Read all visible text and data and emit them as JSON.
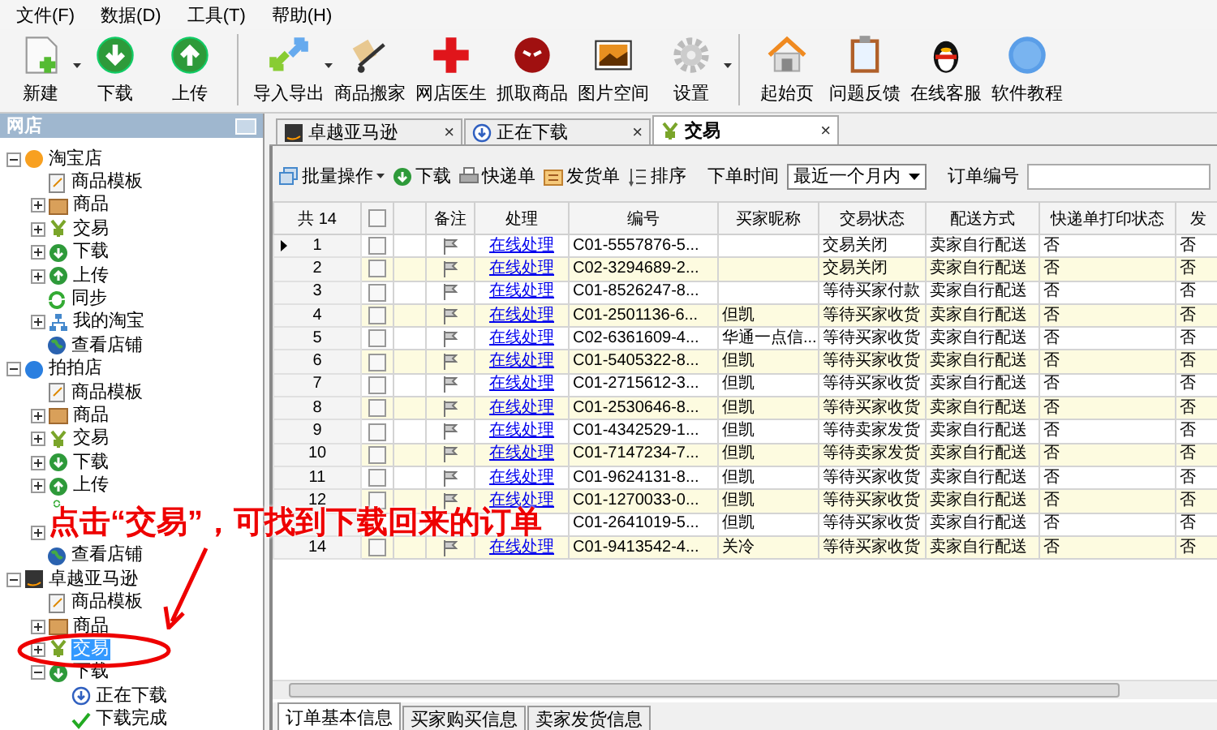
{
  "menu": [
    "文件(F)",
    "数据(D)",
    "工具(T)",
    "帮助(H)"
  ],
  "toolbar": [
    {
      "label": "新建",
      "dropdown": true
    },
    {
      "label": "下载"
    },
    {
      "label": "上传",
      "separator_after": true
    },
    {
      "label": "导入导出",
      "dropdown": true
    },
    {
      "label": "商品搬家"
    },
    {
      "label": "网店医生"
    },
    {
      "label": "抓取商品"
    },
    {
      "label": "图片空间"
    },
    {
      "label": "设置",
      "dropdown": true,
      "separator_after": true
    },
    {
      "label": "起始页"
    },
    {
      "label": "问题反馈"
    },
    {
      "label": "在线客服"
    },
    {
      "label": "软件教程"
    }
  ],
  "sidebar": {
    "title": "网店",
    "tree": [
      {
        "label": "淘宝店",
        "kind": "taobao",
        "expanded": true,
        "selected": false,
        "children": [
          {
            "label": "商品模板",
            "kind": "template",
            "selected": false
          },
          {
            "label": "商品",
            "kind": "box",
            "expanded": false,
            "selected": false
          },
          {
            "label": "交易",
            "kind": "yen",
            "expanded": false,
            "selected": false
          },
          {
            "label": "下载",
            "kind": "download",
            "expanded": false,
            "selected": false
          },
          {
            "label": "上传",
            "kind": "upload",
            "expanded": false,
            "selected": false
          },
          {
            "label": "同步",
            "kind": "sync",
            "selected": false
          },
          {
            "label": "我的淘宝",
            "kind": "sitemap",
            "expanded": false,
            "selected": false
          },
          {
            "label": "查看店铺",
            "kind": "globe",
            "selected": false
          }
        ]
      },
      {
        "label": "拍拍店",
        "kind": "paipai",
        "expanded": true,
        "selected": false,
        "children": [
          {
            "label": "商品模板",
            "kind": "template",
            "selected": false
          },
          {
            "label": "商品",
            "kind": "box",
            "expanded": false,
            "selected": false
          },
          {
            "label": "交易",
            "kind": "yen",
            "expanded": false,
            "selected": false
          },
          {
            "label": "下载",
            "kind": "download",
            "expanded": false,
            "selected": false
          },
          {
            "label": "上传",
            "kind": "upload",
            "expanded": false,
            "selected": false
          },
          {
            "kind": "sync",
            "clipped": true
          },
          {
            "expanded": false
          },
          {
            "label": "查看店铺",
            "kind": "globe",
            "selected": false
          }
        ]
      },
      {
        "label": "卓越亚马逊",
        "kind": "amazon",
        "expanded": true,
        "selected": false,
        "children": [
          {
            "label": "商品模板",
            "kind": "template",
            "selected": false
          },
          {
            "label": "商品",
            "kind": "box",
            "expanded": false,
            "selected": false
          },
          {
            "label": "交易",
            "kind": "yen",
            "expanded": false,
            "selected": true
          },
          {
            "label": "下载",
            "kind": "download",
            "expanded": true,
            "selected": false,
            "children": [
              {
                "label": "正在下载",
                "kind": "downloading",
                "selected": false
              },
              {
                "label": "下载完成",
                "kind": "check",
                "selected": false
              }
            ]
          }
        ]
      }
    ]
  },
  "tabs": [
    {
      "label": "卓越亚马逊",
      "kind": "amazon",
      "selected": false,
      "close": "×"
    },
    {
      "label": "正在下载",
      "kind": "downloading",
      "selected": false,
      "close": "×"
    },
    {
      "label": "交易",
      "kind": "yen",
      "selected": true,
      "close": "×"
    }
  ],
  "order_toolbar": {
    "buttons": [
      {
        "label": "批量操作",
        "dropdown": true
      },
      {
        "label": "下载"
      },
      {
        "label": "快递单"
      },
      {
        "label": "发货单"
      },
      {
        "label": "排序"
      }
    ],
    "time_label": "下单时间",
    "time_value": "最近一个月内",
    "order_no_label": "订单编号"
  },
  "table": {
    "count": "共 14",
    "select_all_checked": false,
    "columns": [
      "",
      "备注",
      "处理",
      "编号",
      "买家昵称",
      "交易状态",
      "配送方式",
      "快递单打印状态",
      "发"
    ],
    "rows": [
      {
        "index": "1",
        "current": true,
        "checked": false,
        "link": "在线处理",
        "id": "C01-5557876-5...",
        "buyer": "",
        "status": "交易关闭",
        "delivery": "卖家自行配送",
        "printed": "否",
        "col_9": "否"
      },
      {
        "index": "2",
        "checked": false,
        "link": "在线处理",
        "id": "C02-3294689-2...",
        "buyer": "",
        "status": "交易关闭",
        "delivery": "卖家自行配送",
        "printed": "否",
        "col_9": "否"
      },
      {
        "index": "3",
        "checked": false,
        "link": "在线处理",
        "id": "C01-8526247-8...",
        "buyer": "",
        "status": "等待买家付款",
        "delivery": "卖家自行配送",
        "printed": "否",
        "col_9": "否"
      },
      {
        "index": "4",
        "checked": false,
        "link": "在线处理",
        "id": "C01-2501136-6...",
        "buyer": "但凯",
        "status": "等待买家收货",
        "delivery": "卖家自行配送",
        "printed": "否",
        "col_9": "否"
      },
      {
        "index": "5",
        "checked": false,
        "link": "在线处理",
        "id": "C02-6361609-4...",
        "buyer": "华通一点信...",
        "status": "等待买家收货",
        "delivery": "卖家自行配送",
        "printed": "否",
        "col_9": "否"
      },
      {
        "index": "6",
        "checked": false,
        "link": "在线处理",
        "id": "C01-5405322-8...",
        "buyer": "但凯",
        "status": "等待买家收货",
        "delivery": "卖家自行配送",
        "printed": "否",
        "col_9": "否"
      },
      {
        "index": "7",
        "checked": false,
        "link": "在线处理",
        "id": "C01-2715612-3...",
        "buyer": "但凯",
        "status": "等待买家收货",
        "delivery": "卖家自行配送",
        "printed": "否",
        "col_9": "否"
      },
      {
        "index": "8",
        "checked": false,
        "link": "在线处理",
        "id": "C01-2530646-8...",
        "buyer": "但凯",
        "status": "等待买家收货",
        "delivery": "卖家自行配送",
        "printed": "否",
        "col_9": "否"
      },
      {
        "index": "9",
        "checked": false,
        "link": "在线处理",
        "id": "C01-4342529-1...",
        "buyer": "但凯",
        "status": "等待卖家发货",
        "delivery": "卖家自行配送",
        "printed": "否",
        "col_9": "否"
      },
      {
        "index": "10",
        "checked": false,
        "link": "在线处理",
        "id": "C01-7147234-7...",
        "buyer": "但凯",
        "status": "等待卖家发货",
        "delivery": "卖家自行配送",
        "printed": "否",
        "col_9": "否"
      },
      {
        "index": "11",
        "checked": false,
        "link": "在线处理",
        "id": "C01-9624131-8...",
        "buyer": "但凯",
        "status": "等待买家收货",
        "delivery": "卖家自行配送",
        "printed": "否",
        "col_9": "否"
      },
      {
        "index": "12",
        "checked": false,
        "link": "在线处理",
        "id": "C01-1270033-0...",
        "buyer": "但凯",
        "status": "等待买家收货",
        "delivery": "卖家自行配送",
        "printed": "否",
        "col_9": "否"
      },
      {
        "id": "C01-2641019-5...",
        "buyer": "但凯",
        "status": "等待买家收货",
        "delivery": "卖家自行配送",
        "printed": "否",
        "col_9": "否"
      },
      {
        "index": "14",
        "checked": false,
        "link": "在线处理",
        "id": "C01-9413542-4...",
        "buyer": "关冷",
        "status": "等待买家收货",
        "delivery": "卖家自行配送",
        "printed": "否",
        "col_9": "否"
      }
    ]
  },
  "bottom_tabs": [
    {
      "label": "订单基本信息",
      "selected": true
    },
    {
      "label": "买家购买信息",
      "selected": false
    },
    {
      "label": "卖家发货信息",
      "selected": false
    }
  ],
  "annotation": {
    "text": "点击“交易”，可找到下载回来的订单"
  }
}
